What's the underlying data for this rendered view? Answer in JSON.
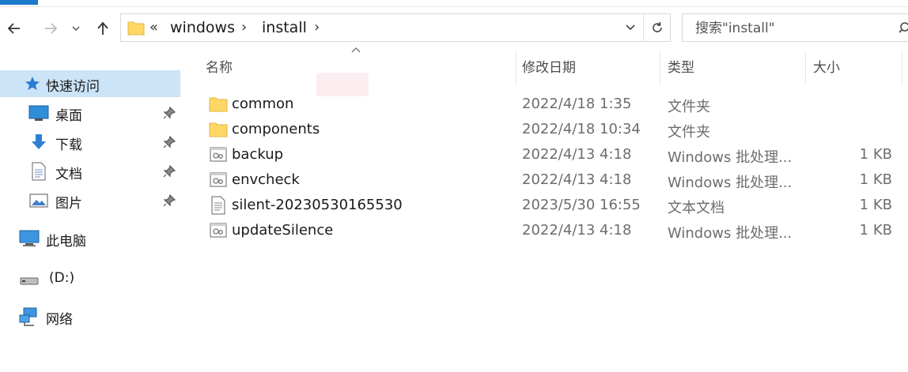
{
  "address_bar": {
    "overflow": "«",
    "crumbs": [
      "windows",
      "install"
    ]
  },
  "search": {
    "placeholder": "搜索\"install\""
  },
  "nav_pane": {
    "items": [
      {
        "label": "快速访问",
        "icon": "star-icon",
        "selected": true,
        "pinned": false
      },
      {
        "label": "桌面",
        "icon": "desktop-icon",
        "selected": false,
        "pinned": true
      },
      {
        "label": "下载",
        "icon": "download-icon",
        "selected": false,
        "pinned": true
      },
      {
        "label": "文档",
        "icon": "document-icon",
        "selected": false,
        "pinned": true
      },
      {
        "label": "图片",
        "icon": "picture-icon",
        "selected": false,
        "pinned": true
      },
      {
        "label": "此电脑",
        "icon": "computer-icon",
        "selected": false,
        "pinned": false
      },
      {
        "label": "(D:)",
        "icon": "drive-icon",
        "selected": false,
        "pinned": false
      },
      {
        "label": "网络",
        "icon": "network-icon",
        "selected": false,
        "pinned": false
      }
    ]
  },
  "columns": {
    "name": "名称",
    "date": "修改日期",
    "type": "类型",
    "size": "大小"
  },
  "files": [
    {
      "name": "common",
      "date": "2022/4/18 1:35",
      "type": "文件夹",
      "size": "",
      "icon": "folder-icon"
    },
    {
      "name": "components",
      "date": "2022/4/18 10:34",
      "type": "文件夹",
      "size": "",
      "icon": "folder-icon"
    },
    {
      "name": "backup",
      "date": "2022/4/13 4:18",
      "type": "Windows 批处理...",
      "size": "1 KB",
      "icon": "batch-file-icon"
    },
    {
      "name": "envcheck",
      "date": "2022/4/13 4:18",
      "type": "Windows 批处理...",
      "size": "1 KB",
      "icon": "batch-file-icon"
    },
    {
      "name": "silent-20230530165530",
      "date": "2023/5/30 16:55",
      "type": "文本文档",
      "size": "1 KB",
      "icon": "text-file-icon"
    },
    {
      "name": "updateSilence",
      "date": "2022/4/13 4:18",
      "type": "Windows 批处理...",
      "size": "1 KB",
      "icon": "batch-file-icon"
    }
  ],
  "colors": {
    "selection": "#cce4f7",
    "folder": "#ffd767",
    "accent": "#1979ca"
  }
}
